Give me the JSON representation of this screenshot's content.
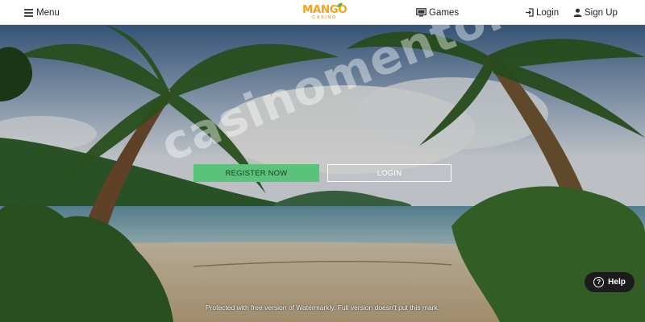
{
  "header": {
    "menu_label": "Menu",
    "logo_main": "MANGO",
    "logo_sub": "CASINO",
    "games_label": "Games",
    "login_label": "Login",
    "signup_label": "Sign Up"
  },
  "hero": {
    "register_label": "REGISTER NOW",
    "login_label": "LOGIN"
  },
  "watermark": {
    "text": "casinomentor",
    "footer": "Protected with free version of Watermarkly. Full version doesn't put this mark."
  },
  "help": {
    "label": "Help",
    "glyph": "?"
  },
  "colors": {
    "brand": "#f5a31a",
    "register_bg": "#5ac27a",
    "help_bg": "#1c1c1c"
  }
}
